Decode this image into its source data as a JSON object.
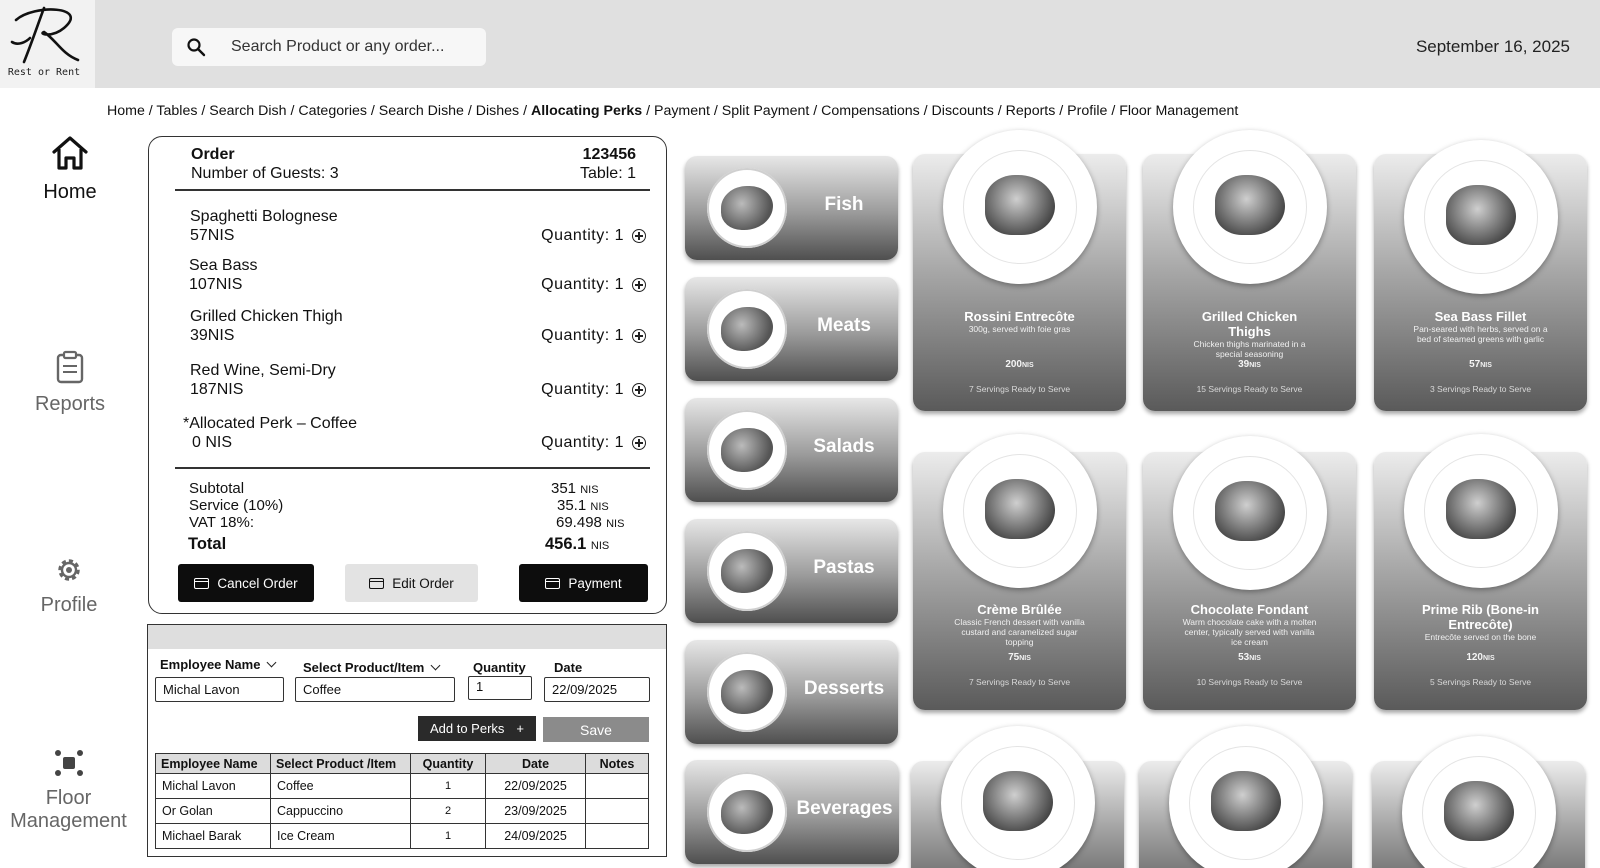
{
  "app": {
    "logo_caption": "Rest or Rent"
  },
  "header": {
    "search_placeholder": "Search Product or any order...",
    "date": "September 16, 2025"
  },
  "breadcrumb": {
    "before": "Home / Tables / Search Dish / Categories / Search Dishe / Dishes / ",
    "active": "Allocating Perks",
    "after": " / Payment / Split Payment / Compensations / Discounts / Reports / Profile / Floor Management"
  },
  "nav": {
    "home": "Home",
    "reports": "Reports",
    "profile": "Profile",
    "floor": "Floor Management"
  },
  "order": {
    "title": "Order",
    "number": "123456",
    "guests": "Number of Guests: 3",
    "table": "Table: 1",
    "items": [
      {
        "name": "Spaghetti Bolognese",
        "price": "57NIS",
        "qty": "Quantity: 1"
      },
      {
        "name": "Sea Bass",
        "price": "107NIS",
        "qty": "Quantity: 1"
      },
      {
        "name": "Grilled Chicken Thigh",
        "price": "39NIS",
        "qty": "Quantity: 1"
      },
      {
        "name": "Red Wine, Semi-Dry",
        "price": "187NIS",
        "qty": "Quantity: 1"
      },
      {
        "name": "*Allocated Perk – Coffee",
        "price": "0 NIS",
        "qty": "Quantity: 1"
      }
    ],
    "summary": {
      "subtotal_label": "Subtotal",
      "subtotal": "351",
      "service_label": "Service (10%)",
      "service": "35.1",
      "vat_label": "VAT 18%:",
      "vat": "69.498",
      "total_label": "Total",
      "total": "456.1",
      "currency": "NIS"
    },
    "buttons": {
      "cancel": "Cancel Order",
      "edit": "Edit Order",
      "payment": "Payment"
    }
  },
  "perks": {
    "employee_label": "Employee Name",
    "product_label": "Select Product/Item",
    "quantity_label": "Quantity",
    "date_label": "Date",
    "employee_value": "Michal Lavon",
    "product_value": "Coffee",
    "quantity_value": "1",
    "date_value": "22/09/2025",
    "add_label": "Add to Perks",
    "add_icon": "+",
    "save_label": "Save",
    "table_headers": [
      "Employee Name",
      "Select Product /Item",
      "Quantity",
      "Date",
      "Notes"
    ],
    "rows": [
      {
        "employee": "Michal Lavon",
        "product": "Coffee",
        "quantity": "1",
        "date": "22/09/2025",
        "notes": ""
      },
      {
        "employee": "Or Golan",
        "product": "Cappuccino",
        "quantity": "2",
        "date": "23/09/2025",
        "notes": ""
      },
      {
        "employee": "Michael Barak",
        "product": "Ice Cream",
        "quantity": "1",
        "date": "24/09/2025",
        "notes": ""
      }
    ]
  },
  "categories": [
    "Fish",
    "Meats",
    "Salads",
    "Pastas",
    "Desserts",
    "Beverages"
  ],
  "dishes": [
    {
      "name": "Rossini Entrecôte",
      "desc": "300g, served with foie gras",
      "price": "200",
      "servings": "7 Servings Ready to Serve"
    },
    {
      "name": "Grilled Chicken Thighs",
      "desc": "Chicken thighs marinated in a special seasoning",
      "price": "39",
      "servings": "15 Servings Ready to Serve"
    },
    {
      "name": "Sea Bass Fillet",
      "desc": "Pan-seared with herbs, served on a bed of steamed greens with garlic",
      "price": "57",
      "servings": "3 Servings Ready to Serve"
    },
    {
      "name": "Crème Brûlée",
      "desc": "Classic French dessert with vanilla custard and caramelized sugar topping",
      "price": "75",
      "servings": "7 Servings Ready to Serve"
    },
    {
      "name": "Chocolate Fondant",
      "desc": "Warm chocolate cake with a molten center, typically served with vanilla ice cream",
      "price": "53",
      "servings": "10 Servings Ready to Serve"
    },
    {
      "name": "Prime Rib (Bone-in Entrecôte)",
      "desc": "Entrecôte served on the bone",
      "price": "120",
      "servings": "5 Servings Ready to Serve"
    }
  ],
  "price_unit": "NIS"
}
